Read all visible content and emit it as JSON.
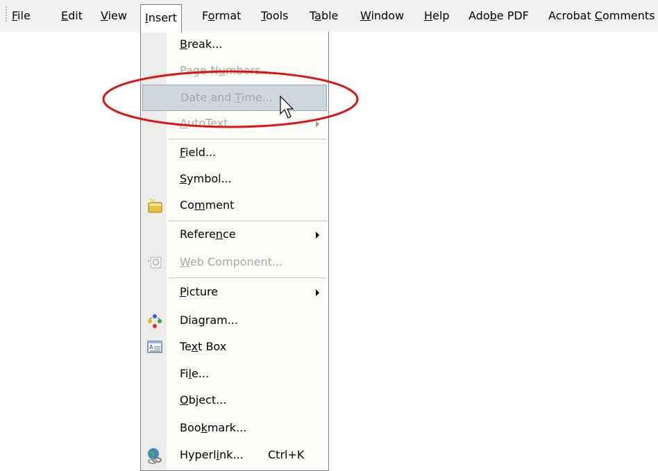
{
  "menubar": {
    "items": [
      {
        "pre": "",
        "key": "F",
        "post": "ile"
      },
      {
        "pre": "",
        "key": "E",
        "post": "dit"
      },
      {
        "pre": "",
        "key": "V",
        "post": "iew"
      },
      {
        "pre": "",
        "key": "I",
        "post": "nsert"
      },
      {
        "pre": "F",
        "key": "o",
        "post": "rmat"
      },
      {
        "pre": "",
        "key": "T",
        "post": "ools"
      },
      {
        "pre": "T",
        "key": "a",
        "post": "ble"
      },
      {
        "pre": "",
        "key": "W",
        "post": "indow"
      },
      {
        "pre": "",
        "key": "H",
        "post": "elp"
      },
      {
        "pre": "Ado",
        "key": "b",
        "post": "e PDF"
      },
      {
        "pre": "Acrobat ",
        "key": "C",
        "post": "omments"
      }
    ]
  },
  "menu": {
    "items": [
      {
        "pre": "",
        "key": "B",
        "post": "reak..."
      },
      {
        "pre": "Page N",
        "key": "u",
        "post": "mbers..."
      },
      {
        "pre": "Date and ",
        "key": "T",
        "post": "ime..."
      },
      {
        "pre": "",
        "key": "A",
        "post": "utoText"
      },
      {
        "pre": "",
        "key": "F",
        "post": "ield..."
      },
      {
        "pre": "",
        "key": "S",
        "post": "ymbol..."
      },
      {
        "pre": "Co",
        "key": "m",
        "post": "ment"
      },
      {
        "pre": "Refere",
        "key": "n",
        "post": "ce"
      },
      {
        "pre": "",
        "key": "W",
        "post": "eb Component..."
      },
      {
        "pre": "",
        "key": "P",
        "post": "icture"
      },
      {
        "pre": "Dia",
        "key": "g",
        "post": "ram..."
      },
      {
        "pre": "Te",
        "key": "x",
        "post": "t Box"
      },
      {
        "pre": "Fi",
        "key": "l",
        "post": "e..."
      },
      {
        "pre": "",
        "key": "O",
        "post": "bject..."
      },
      {
        "pre": "Boo",
        "key": "k",
        "post": "mark..."
      },
      {
        "pre": "Hyperl",
        "key": "i",
        "post": "nk..."
      }
    ],
    "hyperlink_shortcut": "Ctrl+K"
  },
  "icons": {
    "comment": "comment-icon",
    "web_component": "web-component-icon",
    "diagram": "diagram-icon",
    "text_box": "text-box-icon",
    "hyperlink": "hyperlink-icon",
    "cursor": "mouse-pointer-icon"
  },
  "colors": {
    "highlight": "#cfd6e0",
    "annotation_circle": "#e01010",
    "disabled_text": "#a8a8a8"
  }
}
